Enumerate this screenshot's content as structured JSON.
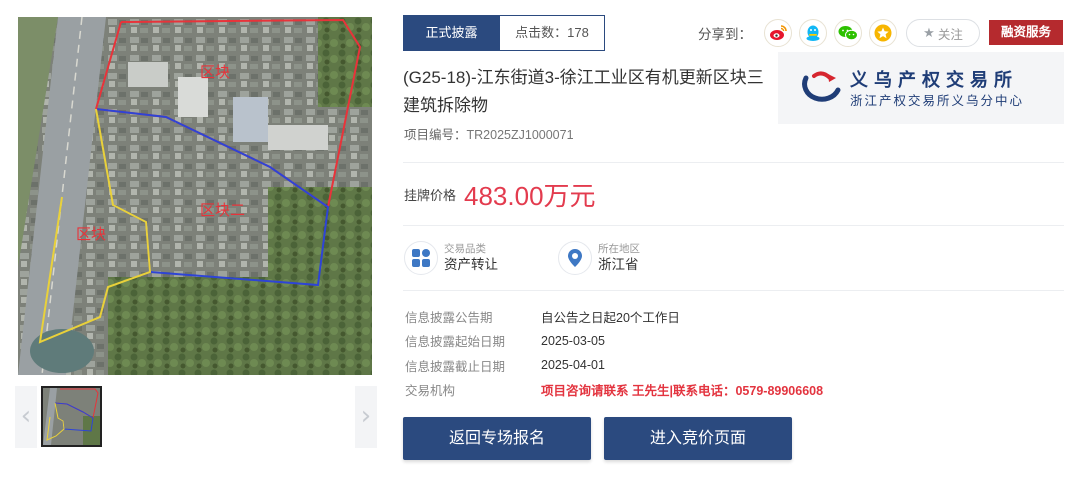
{
  "gallery": {
    "map_labels": [
      "区块",
      "区块二",
      "区块"
    ]
  },
  "tabs": {
    "active_label": "正式披露",
    "clicks_label": "点击数：",
    "clicks_value": "178"
  },
  "share": {
    "label": "分享到：",
    "icons": [
      "weibo-icon",
      "qq-icon",
      "wechat-icon",
      "favorite-icon"
    ],
    "follow_label": "关注"
  },
  "finance_label": "融资服务",
  "exchange": {
    "name": "义乌产权交易所",
    "sub": "浙江产权交易所义乌分中心"
  },
  "project": {
    "title": "(G25-18)-江东街道3-徐江工业区有机更新区块三建筑拆除物",
    "code_label": "项目编号：",
    "code_value": "TR2025ZJ1000071"
  },
  "price": {
    "label": "挂牌价格",
    "value": "483.00万元"
  },
  "attributes": {
    "category_key": "交易品类",
    "category_value": "资产转让",
    "region_key": "所在地区",
    "region_value": "浙江省"
  },
  "info": [
    {
      "key": "信息披露公告期",
      "value": "自公告之日起20个工作日"
    },
    {
      "key": "信息披露起始日期",
      "value": "2025-03-05"
    },
    {
      "key": "信息披露截止日期",
      "value": "2025-04-01"
    },
    {
      "key": "交易机构",
      "value": "项目咨询请联系 王先生|联系电话：0579-89906608"
    }
  ],
  "buttons": {
    "back": "返回专场报名",
    "bid": "进入竞价页面"
  },
  "colors": {
    "primary": "#2b4a7f",
    "price": "#e33b4e",
    "finance": "#b52a2e",
    "contact": "#e3343f"
  }
}
